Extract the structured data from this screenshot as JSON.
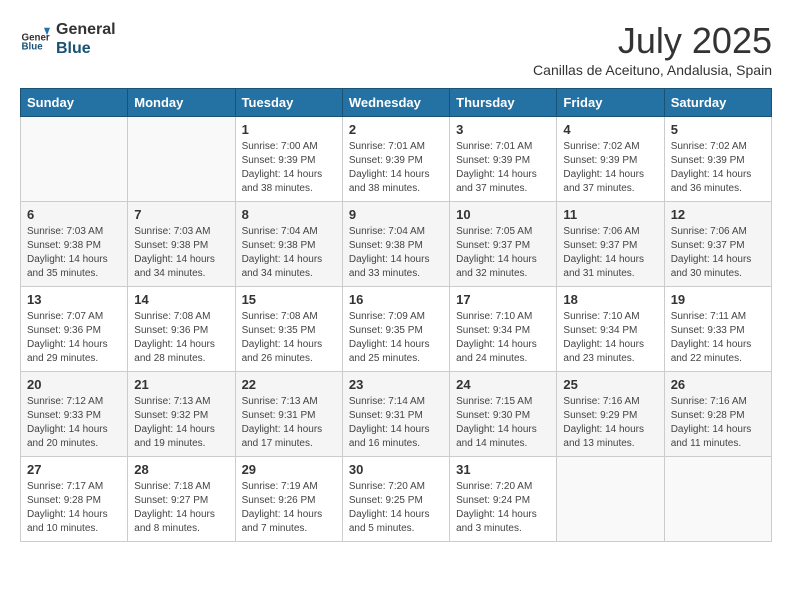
{
  "header": {
    "logo_general": "General",
    "logo_blue": "Blue",
    "month": "July 2025",
    "location": "Canillas de Aceituno, Andalusia, Spain"
  },
  "weekdays": [
    "Sunday",
    "Monday",
    "Tuesday",
    "Wednesday",
    "Thursday",
    "Friday",
    "Saturday"
  ],
  "weeks": [
    [
      {
        "day": "",
        "sunrise": "",
        "sunset": "",
        "daylight": ""
      },
      {
        "day": "",
        "sunrise": "",
        "sunset": "",
        "daylight": ""
      },
      {
        "day": "1",
        "sunrise": "Sunrise: 7:00 AM",
        "sunset": "Sunset: 9:39 PM",
        "daylight": "Daylight: 14 hours and 38 minutes."
      },
      {
        "day": "2",
        "sunrise": "Sunrise: 7:01 AM",
        "sunset": "Sunset: 9:39 PM",
        "daylight": "Daylight: 14 hours and 38 minutes."
      },
      {
        "day": "3",
        "sunrise": "Sunrise: 7:01 AM",
        "sunset": "Sunset: 9:39 PM",
        "daylight": "Daylight: 14 hours and 37 minutes."
      },
      {
        "day": "4",
        "sunrise": "Sunrise: 7:02 AM",
        "sunset": "Sunset: 9:39 PM",
        "daylight": "Daylight: 14 hours and 37 minutes."
      },
      {
        "day": "5",
        "sunrise": "Sunrise: 7:02 AM",
        "sunset": "Sunset: 9:39 PM",
        "daylight": "Daylight: 14 hours and 36 minutes."
      }
    ],
    [
      {
        "day": "6",
        "sunrise": "Sunrise: 7:03 AM",
        "sunset": "Sunset: 9:38 PM",
        "daylight": "Daylight: 14 hours and 35 minutes."
      },
      {
        "day": "7",
        "sunrise": "Sunrise: 7:03 AM",
        "sunset": "Sunset: 9:38 PM",
        "daylight": "Daylight: 14 hours and 34 minutes."
      },
      {
        "day": "8",
        "sunrise": "Sunrise: 7:04 AM",
        "sunset": "Sunset: 9:38 PM",
        "daylight": "Daylight: 14 hours and 34 minutes."
      },
      {
        "day": "9",
        "sunrise": "Sunrise: 7:04 AM",
        "sunset": "Sunset: 9:38 PM",
        "daylight": "Daylight: 14 hours and 33 minutes."
      },
      {
        "day": "10",
        "sunrise": "Sunrise: 7:05 AM",
        "sunset": "Sunset: 9:37 PM",
        "daylight": "Daylight: 14 hours and 32 minutes."
      },
      {
        "day": "11",
        "sunrise": "Sunrise: 7:06 AM",
        "sunset": "Sunset: 9:37 PM",
        "daylight": "Daylight: 14 hours and 31 minutes."
      },
      {
        "day": "12",
        "sunrise": "Sunrise: 7:06 AM",
        "sunset": "Sunset: 9:37 PM",
        "daylight": "Daylight: 14 hours and 30 minutes."
      }
    ],
    [
      {
        "day": "13",
        "sunrise": "Sunrise: 7:07 AM",
        "sunset": "Sunset: 9:36 PM",
        "daylight": "Daylight: 14 hours and 29 minutes."
      },
      {
        "day": "14",
        "sunrise": "Sunrise: 7:08 AM",
        "sunset": "Sunset: 9:36 PM",
        "daylight": "Daylight: 14 hours and 28 minutes."
      },
      {
        "day": "15",
        "sunrise": "Sunrise: 7:08 AM",
        "sunset": "Sunset: 9:35 PM",
        "daylight": "Daylight: 14 hours and 26 minutes."
      },
      {
        "day": "16",
        "sunrise": "Sunrise: 7:09 AM",
        "sunset": "Sunset: 9:35 PM",
        "daylight": "Daylight: 14 hours and 25 minutes."
      },
      {
        "day": "17",
        "sunrise": "Sunrise: 7:10 AM",
        "sunset": "Sunset: 9:34 PM",
        "daylight": "Daylight: 14 hours and 24 minutes."
      },
      {
        "day": "18",
        "sunrise": "Sunrise: 7:10 AM",
        "sunset": "Sunset: 9:34 PM",
        "daylight": "Daylight: 14 hours and 23 minutes."
      },
      {
        "day": "19",
        "sunrise": "Sunrise: 7:11 AM",
        "sunset": "Sunset: 9:33 PM",
        "daylight": "Daylight: 14 hours and 22 minutes."
      }
    ],
    [
      {
        "day": "20",
        "sunrise": "Sunrise: 7:12 AM",
        "sunset": "Sunset: 9:33 PM",
        "daylight": "Daylight: 14 hours and 20 minutes."
      },
      {
        "day": "21",
        "sunrise": "Sunrise: 7:13 AM",
        "sunset": "Sunset: 9:32 PM",
        "daylight": "Daylight: 14 hours and 19 minutes."
      },
      {
        "day": "22",
        "sunrise": "Sunrise: 7:13 AM",
        "sunset": "Sunset: 9:31 PM",
        "daylight": "Daylight: 14 hours and 17 minutes."
      },
      {
        "day": "23",
        "sunrise": "Sunrise: 7:14 AM",
        "sunset": "Sunset: 9:31 PM",
        "daylight": "Daylight: 14 hours and 16 minutes."
      },
      {
        "day": "24",
        "sunrise": "Sunrise: 7:15 AM",
        "sunset": "Sunset: 9:30 PM",
        "daylight": "Daylight: 14 hours and 14 minutes."
      },
      {
        "day": "25",
        "sunrise": "Sunrise: 7:16 AM",
        "sunset": "Sunset: 9:29 PM",
        "daylight": "Daylight: 14 hours and 13 minutes."
      },
      {
        "day": "26",
        "sunrise": "Sunrise: 7:16 AM",
        "sunset": "Sunset: 9:28 PM",
        "daylight": "Daylight: 14 hours and 11 minutes."
      }
    ],
    [
      {
        "day": "27",
        "sunrise": "Sunrise: 7:17 AM",
        "sunset": "Sunset: 9:28 PM",
        "daylight": "Daylight: 14 hours and 10 minutes."
      },
      {
        "day": "28",
        "sunrise": "Sunrise: 7:18 AM",
        "sunset": "Sunset: 9:27 PM",
        "daylight": "Daylight: 14 hours and 8 minutes."
      },
      {
        "day": "29",
        "sunrise": "Sunrise: 7:19 AM",
        "sunset": "Sunset: 9:26 PM",
        "daylight": "Daylight: 14 hours and 7 minutes."
      },
      {
        "day": "30",
        "sunrise": "Sunrise: 7:20 AM",
        "sunset": "Sunset: 9:25 PM",
        "daylight": "Daylight: 14 hours and 5 minutes."
      },
      {
        "day": "31",
        "sunrise": "Sunrise: 7:20 AM",
        "sunset": "Sunset: 9:24 PM",
        "daylight": "Daylight: 14 hours and 3 minutes."
      },
      {
        "day": "",
        "sunrise": "",
        "sunset": "",
        "daylight": ""
      },
      {
        "day": "",
        "sunrise": "",
        "sunset": "",
        "daylight": ""
      }
    ]
  ]
}
